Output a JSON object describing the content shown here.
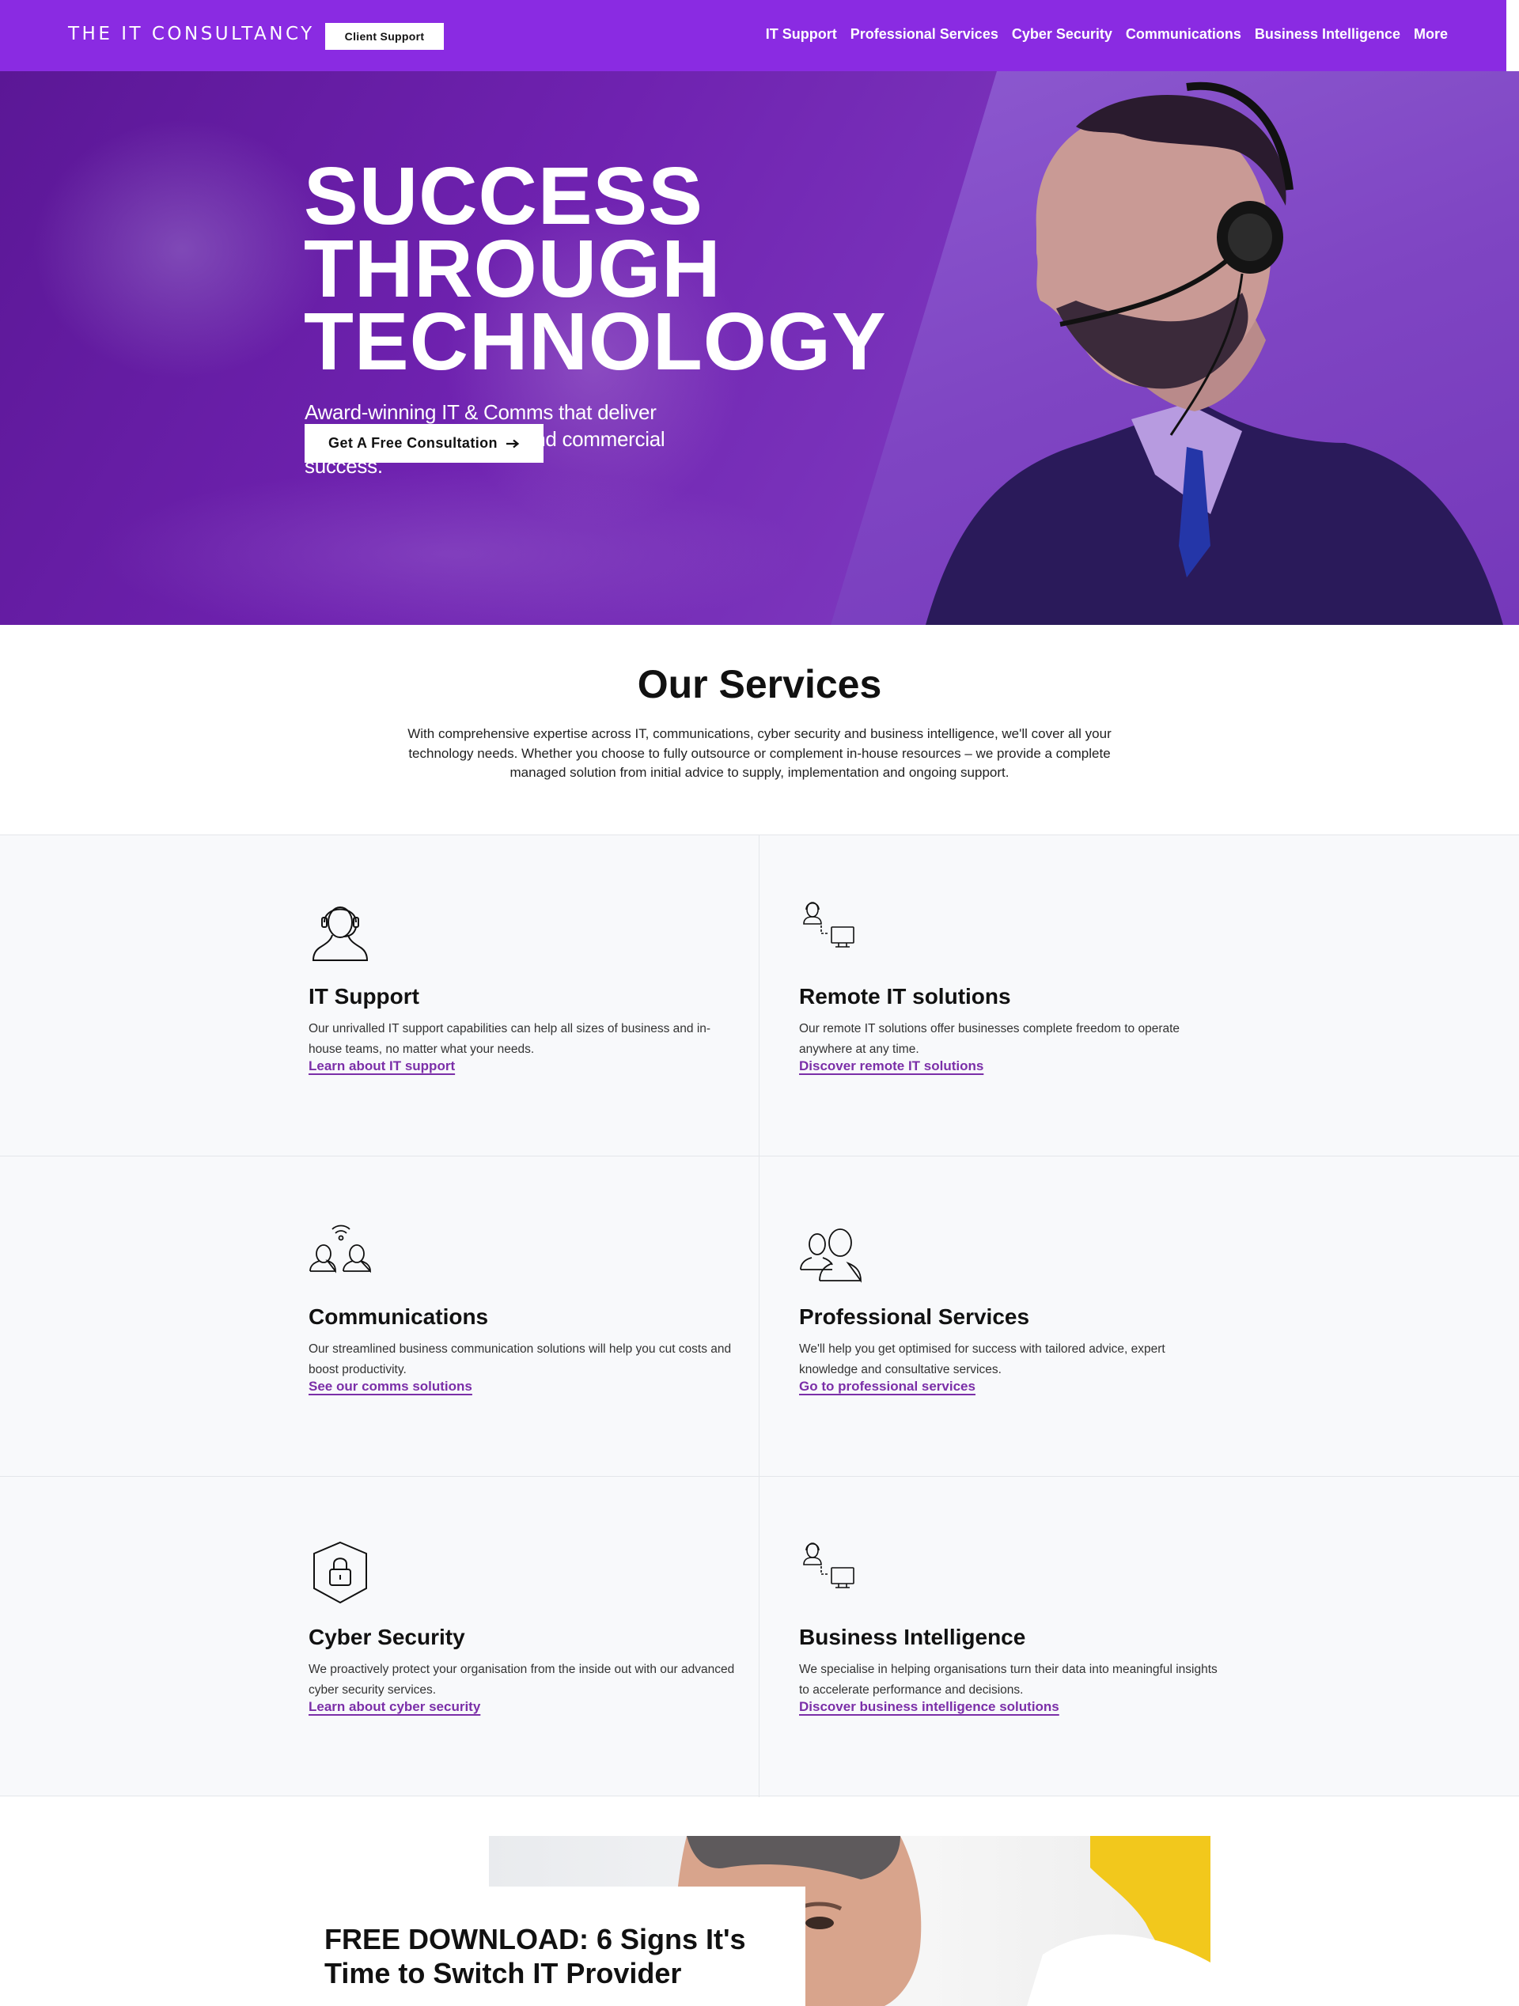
{
  "header": {
    "logo": "THE IT CONSULTANCY",
    "client_support": "Client Support",
    "nav": [
      "IT Support",
      "Professional Services",
      "Cyber Security",
      "Communications",
      "Business Intelligence",
      "More"
    ]
  },
  "hero": {
    "title_lines": [
      "SUCCESS",
      "THROUGH",
      "TECHNOLOGY"
    ],
    "subtitle": "Award-winning IT & Comms that deliver business transformation and commercial success.",
    "cta": "Get A Free Consultation",
    "cta_icon": "arrow-right-icon"
  },
  "services": {
    "title": "Our Services",
    "description": "With comprehensive expertise across IT, communications, cyber security and business intelligence, we'll cover all your technology needs. Whether you choose to fully outsource or complement in-house resources – we provide a complete managed solution from initial advice to supply, implementation and ongoing support.",
    "cards": [
      {
        "icon": "headset-person-icon",
        "title": "IT Support",
        "text": "Our unrivalled IT support capabilities can help all sizes of business and in-house teams, no matter what your needs.",
        "link": "Learn about IT support"
      },
      {
        "icon": "remote-person-computer-icon",
        "title": "Remote IT solutions",
        "text": "Our remote IT solutions offer businesses complete freedom to operate anywhere at any time.",
        "link": "Discover remote IT solutions"
      },
      {
        "icon": "people-wifi-icon",
        "title": "Communications",
        "text": "Our streamlined business communication solutions will help you cut costs and boost productivity.",
        "link": "See our comms solutions"
      },
      {
        "icon": "people-group-icon",
        "title": "Professional Services",
        "text": "We'll help you get optimised for success with tailored advice, expert knowledge and consultative services.",
        "link": "Go to professional services"
      },
      {
        "icon": "shield-lock-icon",
        "title": "Cyber Security",
        "text": "We proactively protect your organisation from the inside out with our advanced cyber security services.",
        "link": "Learn about cyber security"
      },
      {
        "icon": "person-computer-icon",
        "title": "Business Intelligence",
        "text": "We specialise in helping organisations turn their data into meaningful insights to accelerate performance and decisions.",
        "link": "Discover business intelligence solutions"
      }
    ]
  },
  "download": {
    "title": "FREE DOWNLOAD: 6 Signs It's Time to Switch IT Provider"
  },
  "colors": {
    "brand_purple": "#8a2be2",
    "link_purple": "#7b2fa8",
    "grid_background": "#f8f9fb"
  }
}
